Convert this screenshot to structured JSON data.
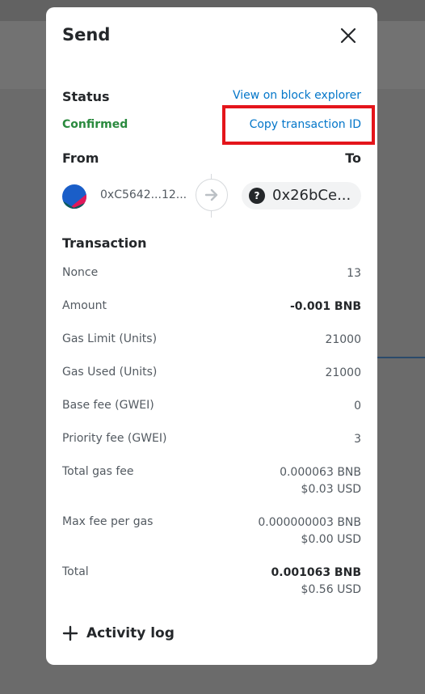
{
  "modal": {
    "title": "Send",
    "close_icon": "close-icon"
  },
  "status": {
    "label": "Status",
    "value": "Confirmed",
    "view_link": "View on block explorer",
    "copy_link": "Copy transaction ID",
    "status_color": "#2a8a3e",
    "link_color": "#0376c9",
    "highlight_color": "#e4151b"
  },
  "parties": {
    "from_label": "From",
    "to_label": "To",
    "from_address": "0xC5642...12...",
    "to_address": "0x26bCe...",
    "to_icon": "question-icon",
    "arrow_icon": "arrow-right-icon"
  },
  "transaction": {
    "label": "Transaction",
    "rows": [
      {
        "label": "Nonce",
        "value": "13"
      },
      {
        "label": "Amount",
        "value": "-0.001 BNB"
      },
      {
        "label": "Gas Limit (Units)",
        "value": "21000"
      },
      {
        "label": "Gas Used (Units)",
        "value": "21000"
      },
      {
        "label": "Base fee (GWEI)",
        "value": "0"
      },
      {
        "label": "Priority fee (GWEI)",
        "value": "3"
      },
      {
        "label": "Total gas fee",
        "value": "0.000063 BNB",
        "value2": "$0.03 USD"
      },
      {
        "label": "Max fee per gas",
        "value": "0.000000003 BNB",
        "value2": "$0.00 USD"
      },
      {
        "label": "Total",
        "value": "0.001063 BNB",
        "value2": "$0.56 USD"
      }
    ]
  },
  "activity_log": {
    "label": "Activity log",
    "icon": "plus-icon"
  }
}
